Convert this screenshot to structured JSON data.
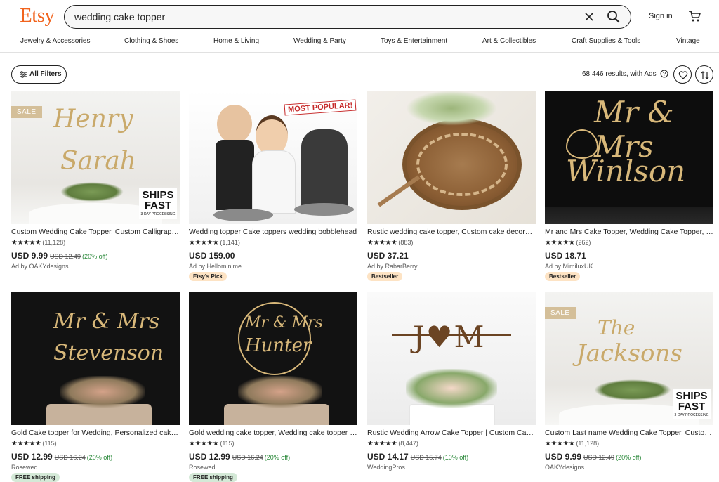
{
  "header": {
    "logo": "Etsy",
    "search_value": "wedding cake topper",
    "signin": "Sign in"
  },
  "categories": [
    "Jewelry & Accessories",
    "Clothing & Shoes",
    "Home & Living",
    "Wedding & Party",
    "Toys & Entertainment",
    "Art & Collectibles",
    "Craft Supplies & Tools",
    "Vintage"
  ],
  "toolbar": {
    "filters_label": "All Filters",
    "results_text": "68,446 results, with Ads"
  },
  "listings": [
    {
      "title": "Custom Wedding Cake Topper, Custom Calligraphy Cake Topper",
      "stars": "★★★★★",
      "count": "(11,128)",
      "price": "USD 9.99",
      "orig": "USD 12.49",
      "disc": "(20% off)",
      "seller": "Ad by OAKYdesigns",
      "badge": "",
      "sale": "SALE",
      "ships_big": "SHIPS FAST",
      "ships_small": "3-DAY PROCESSING",
      "img_text1": "Henry",
      "img_text2": "Sarah",
      "popular": ""
    },
    {
      "title": "Wedding topper Cake toppers wedding bobblehead",
      "stars": "★★★★★",
      "count": "(1,141)",
      "price": "USD 159.00",
      "orig": "",
      "disc": "",
      "seller": "Ad by Hellominime",
      "badge": "Etsy's Pick",
      "sale": "",
      "ships_big": "",
      "ships_small": "",
      "img_text1": "",
      "img_text2": "",
      "popular": "MOST POPULAR!"
    },
    {
      "title": "Rustic wedding cake topper, Custom cake decoration",
      "stars": "★★★★★",
      "count": "(883)",
      "price": "USD 37.21",
      "orig": "",
      "disc": "",
      "seller": "Ad by RabarBerry",
      "badge": "Bestseller",
      "sale": "",
      "ships_big": "",
      "ships_small": "",
      "img_text1": "",
      "img_text2": "",
      "popular": ""
    },
    {
      "title": "Mr and Mrs Cake Topper, Wedding Cake Topper, Custom",
      "stars": "★★★★★",
      "count": "(262)",
      "price": "USD 18.71",
      "orig": "",
      "disc": "",
      "seller": "Ad by MimiluxUK",
      "badge": "Bestseller",
      "sale": "",
      "ships_big": "",
      "ships_small": "",
      "img_text1": "Mr & Mrs",
      "img_text2": "Winlson",
      "popular": ""
    },
    {
      "title": "Gold Cake topper for Wedding, Personalized cake topper",
      "stars": "★★★★★",
      "count": "(115)",
      "price": "USD 12.99",
      "orig": "USD 16.24",
      "disc": "(20% off)",
      "seller": "Rosewed",
      "badge": "FREE shipping",
      "sale": "",
      "ships_big": "",
      "ships_small": "",
      "img_text1": "Mr & Mrs",
      "img_text2": "Stevenson",
      "popular": ""
    },
    {
      "title": "Gold wedding cake topper, Wedding cake topper gold",
      "stars": "★★★★★",
      "count": "(115)",
      "price": "USD 12.99",
      "orig": "USD 16.24",
      "disc": "(20% off)",
      "seller": "Rosewed",
      "badge": "FREE shipping",
      "sale": "",
      "ships_big": "",
      "ships_small": "",
      "img_text1": "Mr & Mrs",
      "img_text2": "Hunter",
      "popular": ""
    },
    {
      "title": "Rustic Wedding Arrow Cake Topper | Custom Cake Topper",
      "stars": "★★★★★",
      "count": "(8,447)",
      "price": "USD 14.17",
      "orig": "USD 15.74",
      "disc": "(10% off)",
      "seller": "WeddingPros",
      "badge": "",
      "sale": "",
      "ships_big": "",
      "ships_small": "",
      "img_text1": "J♥M",
      "img_text2": "",
      "popular": ""
    },
    {
      "title": "Custom Last name Wedding Cake Topper, Custom Cake Topper",
      "stars": "★★★★★",
      "count": "(11,128)",
      "price": "USD 9.99",
      "orig": "USD 12.49",
      "disc": "(20% off)",
      "seller": "OAKYdesigns",
      "badge": "",
      "sale": "SALE",
      "ships_big": "SHIPS FAST",
      "ships_small": "3-DAY PROCESSING",
      "img_text1": "The",
      "img_text2": "Jacksons",
      "popular": ""
    }
  ],
  "colors": {
    "brand": "#F1641E",
    "discount": "#258635",
    "sale_tag": "#d4bf99"
  }
}
